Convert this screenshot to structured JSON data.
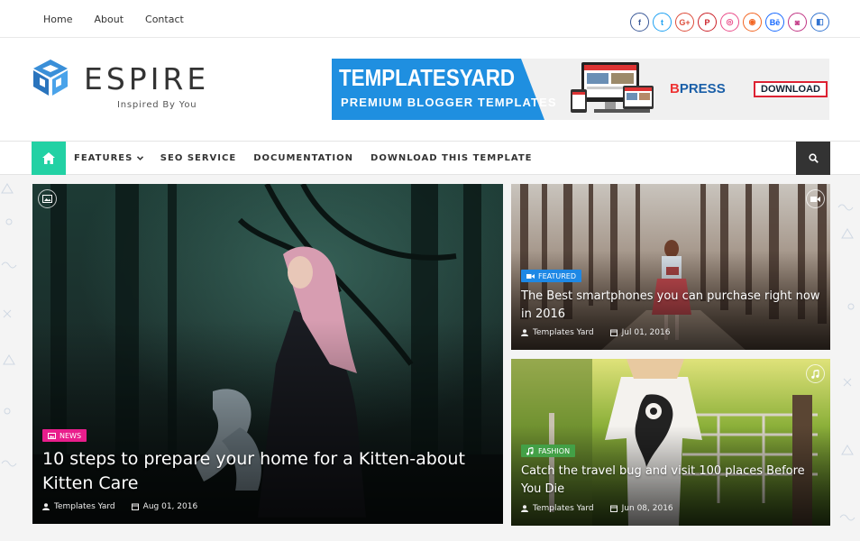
{
  "topbar": {
    "links": [
      "Home",
      "About",
      "Contact"
    ],
    "social_icons": [
      {
        "name": "facebook-icon",
        "glyph": "f",
        "color": "#3b5998"
      },
      {
        "name": "twitter-icon",
        "glyph": "t",
        "color": "#1da1f2"
      },
      {
        "name": "google-plus-icon",
        "glyph": "G+",
        "color": "#dd4b39"
      },
      {
        "name": "pinterest-icon",
        "glyph": "P",
        "color": "#cb2027"
      },
      {
        "name": "dribbble-icon",
        "glyph": "◎",
        "color": "#ea4c89"
      },
      {
        "name": "rss-icon",
        "glyph": "◉",
        "color": "#f26522"
      },
      {
        "name": "behance-icon",
        "glyph": "Bē",
        "color": "#1769ff"
      },
      {
        "name": "instagram-icon",
        "glyph": "◙",
        "color": "#c13584"
      },
      {
        "name": "delicious-icon",
        "glyph": "◧",
        "color": "#3274d1"
      }
    ]
  },
  "header": {
    "logo_name": "ESPIRE",
    "tagline": "Inspired By You",
    "banner": {
      "title": "TEMPLATESYARD",
      "subtitle": "PREMIUM BLOGGER TEMPLATES",
      "press_b": "B",
      "press_rest": "PRESS",
      "download": "DOWNLOAD"
    }
  },
  "nav": {
    "items": [
      "FEATURES",
      "SEO SERVICE",
      "DOCUMENTATION",
      "DOWNLOAD THIS TEMPLATE"
    ]
  },
  "posts": [
    {
      "category": "NEWS",
      "category_color": "#e91e8c",
      "title": "10 steps to prepare your home for a Kitten-about Kitten Care",
      "author": "Templates Yard",
      "date": "Aug 01, 2016",
      "format_icon": "image-icon"
    },
    {
      "category": "FEATURED",
      "category_color": "#1e88e5",
      "title": "The Best smartphones you can purchase right now in 2016",
      "author": "Templates Yard",
      "date": "Jul 01, 2016",
      "format_icon": "video-icon"
    },
    {
      "category": "FASHION",
      "category_color": "#43a047",
      "title": "Catch the travel bug and visit 100 places Before You Die",
      "author": "Templates Yard",
      "date": "Jun 08, 2016",
      "format_icon": "music-icon"
    }
  ]
}
